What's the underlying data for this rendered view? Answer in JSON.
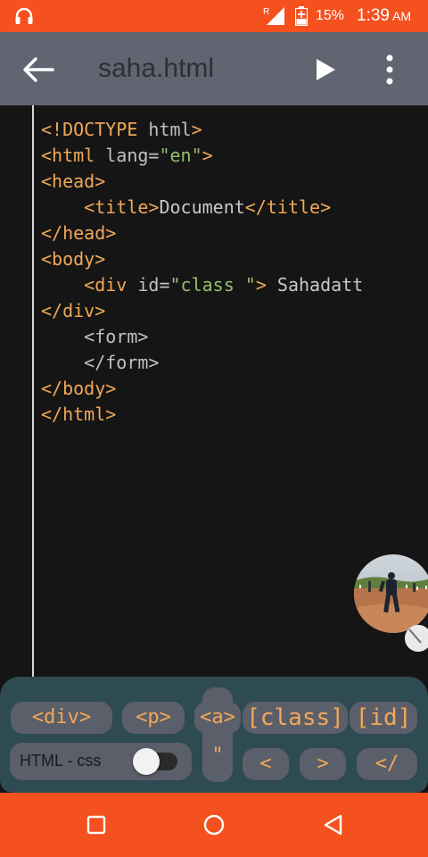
{
  "status_bar": {
    "icons": [
      "headset-icon",
      "signal-roaming-icon",
      "battery-charging-icon"
    ],
    "roaming_mark": "R",
    "battery_percent": "15%",
    "time": "1:39",
    "ampm": "AM"
  },
  "toolbar": {
    "title": "saha.html",
    "icons": [
      "back-arrow-icon",
      "play-icon",
      "more-vert-icon"
    ]
  },
  "editor": {
    "lines": [
      [
        {
          "t": "tag",
          "v": "<!DOCTYPE"
        },
        {
          "t": "attr",
          "v": " html"
        },
        {
          "t": "tag",
          "v": ">"
        }
      ],
      [
        {
          "t": "tag",
          "v": "<html"
        },
        {
          "t": "attr",
          "v": " lang="
        },
        {
          "t": "str",
          "v": "\"en\""
        },
        {
          "t": "tag",
          "v": ">"
        }
      ],
      [
        {
          "t": "tag",
          "v": "<head>"
        }
      ],
      [
        {
          "t": "txt",
          "v": "    "
        },
        {
          "t": "tag",
          "v": "<title>"
        },
        {
          "t": "txt",
          "v": "Document"
        },
        {
          "t": "tag",
          "v": "</title>"
        }
      ],
      [
        {
          "t": "tag",
          "v": "</head>"
        }
      ],
      [
        {
          "t": "tag",
          "v": "<body>"
        }
      ],
      [
        {
          "t": "txt",
          "v": "    "
        },
        {
          "t": "tag",
          "v": "<div"
        },
        {
          "t": "attr",
          "v": " id="
        },
        {
          "t": "str",
          "v": "\"class \""
        },
        {
          "t": "tag",
          "v": ">"
        },
        {
          "t": "txt",
          "v": " Sahadatt"
        }
      ],
      [
        {
          "t": "tag",
          "v": "</div>"
        }
      ],
      [
        {
          "t": "txt",
          "v": "    "
        },
        {
          "t": "attr",
          "v": "<form>"
        }
      ],
      [
        {
          "t": "txt",
          "v": "    "
        },
        {
          "t": "attr",
          "v": "</form>"
        }
      ],
      [
        {
          "t": "tag",
          "v": "</body>"
        }
      ],
      [
        {
          "t": "tag",
          "v": "</html>"
        }
      ]
    ]
  },
  "bubble": {
    "icons": [
      "avatar-photo",
      "close-bubble-icon"
    ]
  },
  "snippets": {
    "div": "<div>",
    "p": "<p>",
    "a": "<a>",
    "class": "[class]",
    "id": "[id]",
    "quote": "\"",
    "lt": "<",
    "gt": ">",
    "close": "</",
    "toggle_label": "HTML - css",
    "toggle_on": false
  },
  "nav_bar": {
    "icons": [
      "recents-square-icon",
      "home-circle-icon",
      "back-triangle-icon"
    ]
  },
  "colors": {
    "accent": "#f4511e",
    "toolbar": "#616572",
    "editor_bg": "#151515",
    "tag": "#f0a859",
    "string": "#97bf6e",
    "attr": "#c0c0c0",
    "snippet_bar": "#2e4a52",
    "key_bg": "#5b5f69"
  }
}
